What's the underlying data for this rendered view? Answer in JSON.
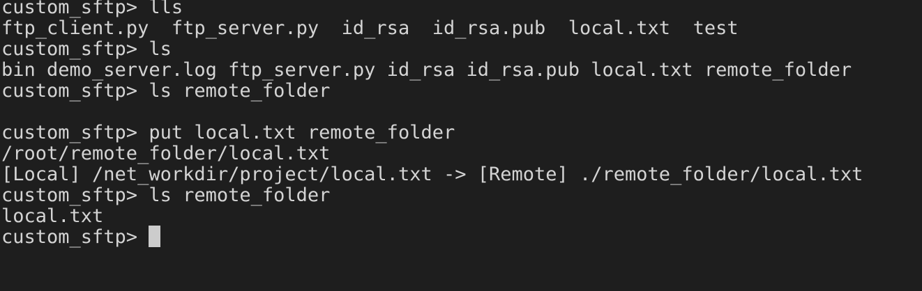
{
  "terminal": {
    "lines": [
      "custom_sftp> lls",
      "ftp_client.py  ftp_server.py  id_rsa  id_rsa.pub  local.txt  test",
      "custom_sftp> ls",
      "bin demo_server.log ftp_server.py id_rsa id_rsa.pub local.txt remote_folder",
      "custom_sftp> ls remote_folder",
      "",
      "custom_sftp> put local.txt remote_folder",
      "/root/remote_folder/local.txt",
      "[Local] /net_workdir/project/local.txt -> [Remote] ./remote_folder/local.txt",
      "custom_sftp> ls remote_folder",
      "local.txt",
      "custom_sftp> "
    ]
  },
  "colors": {
    "background": "#1e1e1e",
    "foreground": "#d4d4d4",
    "cursor": "#cccccc"
  }
}
